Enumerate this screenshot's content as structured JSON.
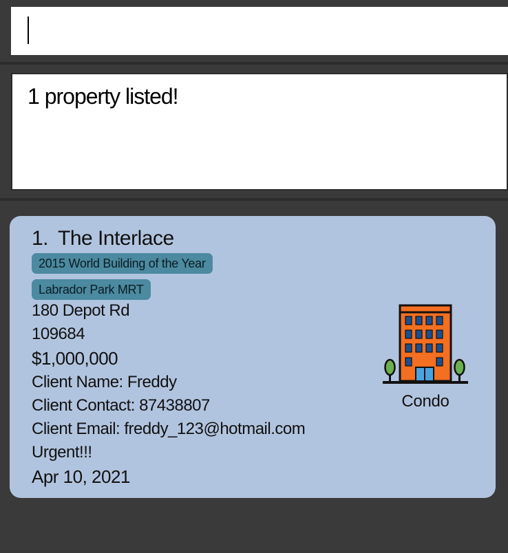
{
  "command": {
    "value": "",
    "placeholder": ""
  },
  "result": {
    "message": "1 property listed!"
  },
  "property": {
    "index": "1.",
    "name": "The Interlace",
    "tags": [
      "2015 World Building of the Year",
      "Labrador Park MRT"
    ],
    "address": "180 Depot Rd",
    "postal": "109684",
    "price": "$1,000,000",
    "client_name": "Client Name: Freddy",
    "client_contact": "Client Contact: 87438807",
    "client_email": "Client Email: freddy_123@hotmail.com",
    "remark": "Urgent!!!",
    "deadline": "Apr 10, 2021",
    "type": "Condo",
    "icon": "condo-building-icon"
  },
  "colors": {
    "background": "#3a3a3a",
    "card": "#b1c4df",
    "tag": "#4b8aa0",
    "panel": "#ffffff"
  }
}
